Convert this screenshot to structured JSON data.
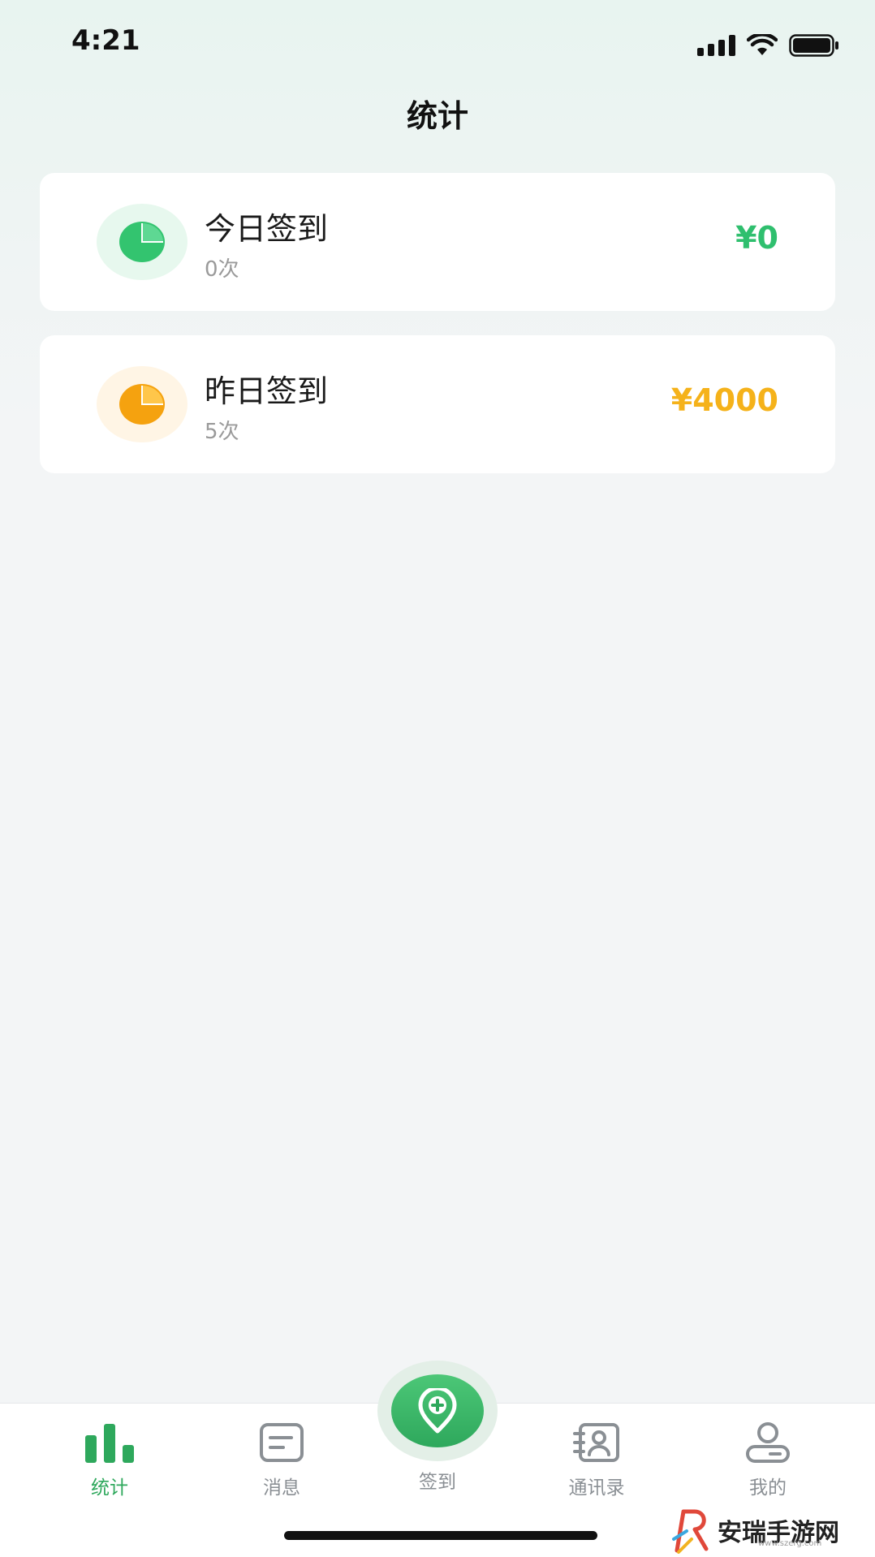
{
  "status_bar": {
    "time": "4:21"
  },
  "header": {
    "title": "统计"
  },
  "cards": [
    {
      "title": "今日签到",
      "count": "0次",
      "amount": "¥0",
      "icon": "pie-chart-icon",
      "accent": "#2fbf6e"
    },
    {
      "title": "昨日签到",
      "count": "5次",
      "amount": "¥4000",
      "icon": "pie-chart-icon",
      "accent": "#f5b21a"
    }
  ],
  "tab_bar": {
    "active_color": "#2ea85c",
    "inactive_color": "#8a8f94",
    "tabs": [
      {
        "label": "统计",
        "icon": "bar-chart-icon"
      },
      {
        "label": "消息",
        "icon": "message-icon"
      },
      {
        "label": "签到",
        "icon": "location-plus-icon"
      },
      {
        "label": "通讯录",
        "icon": "contacts-icon"
      },
      {
        "label": "我的",
        "icon": "user-icon"
      }
    ]
  },
  "watermark": {
    "text": "安瑞手游网",
    "sub": "www.szerg.com"
  }
}
